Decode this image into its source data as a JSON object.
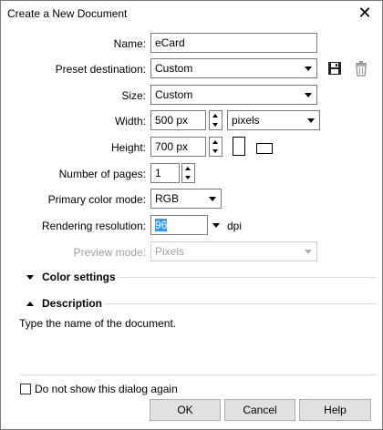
{
  "window": {
    "title": "Create a New Document",
    "close_glyph": "✕"
  },
  "fields": {
    "name": {
      "label": "Name:",
      "value": "eCard"
    },
    "preset_destination": {
      "label": "Preset destination:",
      "value": "Custom"
    },
    "size": {
      "label": "Size:",
      "value": "Custom"
    },
    "width": {
      "label": "Width:",
      "value": "500 px",
      "unit": "pixels"
    },
    "height": {
      "label": "Height:",
      "value": "700 px"
    },
    "number_of_pages": {
      "label": "Number of pages:",
      "value": "1"
    },
    "primary_color_mode": {
      "label": "Primary color mode:",
      "value": "RGB"
    },
    "rendering_resolution": {
      "label": "Rendering resolution:",
      "value": "96",
      "unit": "dpi"
    },
    "preview_mode": {
      "label": "Preview mode:",
      "value": "Pixels"
    }
  },
  "sections": {
    "color_settings": "Color settings",
    "description": "Description"
  },
  "description_text": "Type the name of the document.",
  "footer": {
    "dont_show": "Do not show this dialog again",
    "ok": "OK",
    "cancel": "Cancel",
    "help": "Help"
  },
  "icons": {
    "save": "floppy-disk",
    "delete": "trash-can",
    "portrait": "portrait-page",
    "landscape": "landscape-page"
  }
}
